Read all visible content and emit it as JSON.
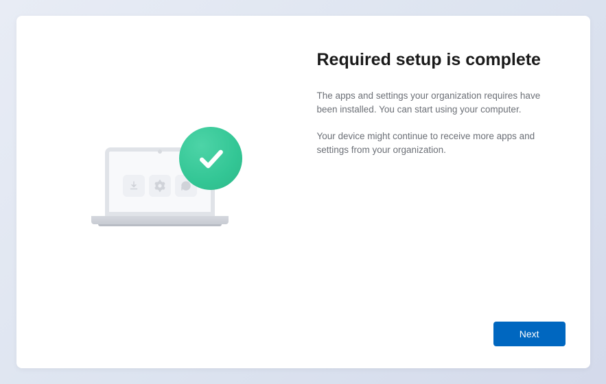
{
  "title": "Required setup is complete",
  "description1": "The apps and settings your organization requires have been installed. You can start using your computer.",
  "description2": "Your device might continue to receive more apps and settings from your organization.",
  "buttons": {
    "next": "Next"
  }
}
